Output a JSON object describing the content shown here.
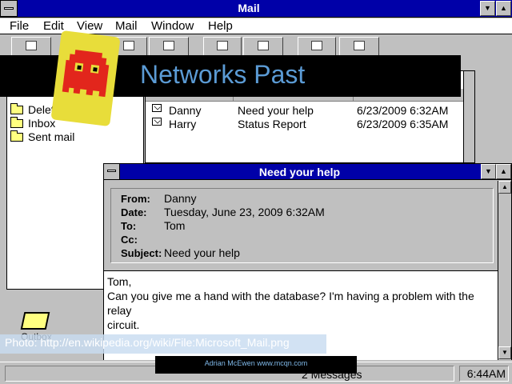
{
  "app": {
    "title": "Mail"
  },
  "menu": [
    "File",
    "Edit",
    "View",
    "Mail",
    "Window",
    "Help"
  ],
  "folders": [
    "Deleted mail",
    "Inbox",
    "Sent mail"
  ],
  "message_list": {
    "rows": [
      {
        "from": "Danny",
        "subject": "Need your help",
        "received": "6/23/2009 6:32AM"
      },
      {
        "from": "Harry",
        "subject": "Status Report",
        "received": "6/23/2009 6:35AM"
      }
    ]
  },
  "outbox": {
    "label": "Outbox"
  },
  "message_window": {
    "title": "Need your help",
    "header_labels": {
      "from": "From:",
      "date": "Date:",
      "to": "To:",
      "cc": "Cc:",
      "subject": "Subject:"
    },
    "from": "Danny",
    "date": "Tuesday, June 23, 2009 6:32AM",
    "to": "Tom",
    "cc": "",
    "subject": "Need your help",
    "body_lines": [
      "Tom,",
      "Can you give me a hand with the database? I'm having a problem with the relay",
      "circuit."
    ]
  },
  "status": {
    "count": "2 Messages",
    "time": "6:44AM"
  },
  "overlay": {
    "banner_title": "Networks Past",
    "photo_credit": "Photo: http://en.wikipedia.org/wiki/File:Microsoft_Mail.png",
    "footer": "Adrian McEwen  www.mcqn.com"
  },
  "colors": {
    "title_bar": "#0000a8",
    "face": "#c0c0c0",
    "banner_text": "#5b9bd5",
    "logo_bg": "#e8dd3a",
    "ghost": "#e2261c"
  }
}
